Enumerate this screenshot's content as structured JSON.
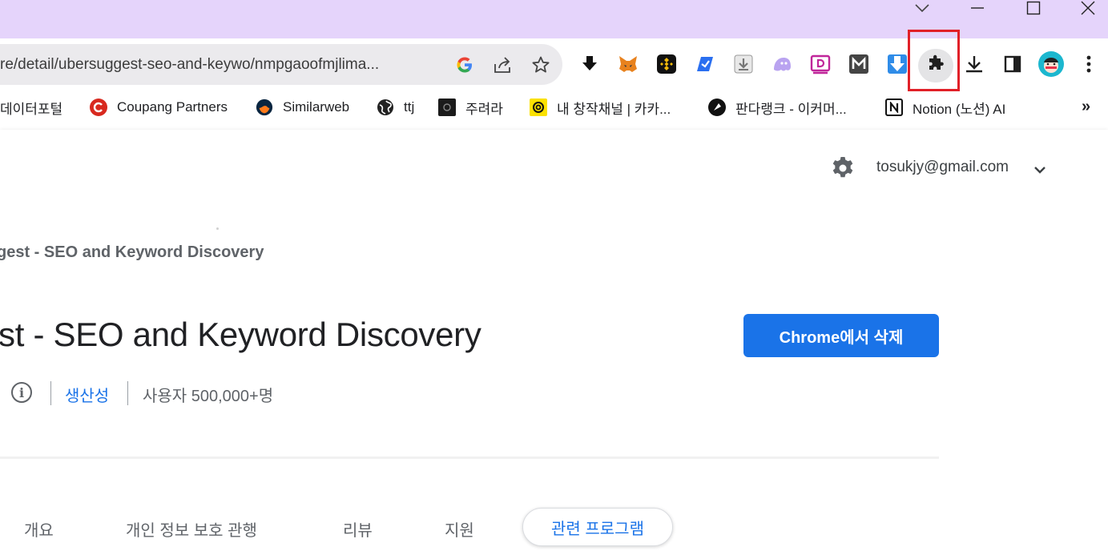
{
  "browser": {
    "url_text": "re/detail/ubersuggest-seo-and-keywo/nmpgaoofmjlima...",
    "accent_color": "#e5d4fb"
  },
  "bookmarks": [
    {
      "label": "데이터포털",
      "icon": "none"
    },
    {
      "label": "Coupang Partners",
      "icon": "coupang-icon"
    },
    {
      "label": "Similarweb",
      "icon": "similarweb-icon"
    },
    {
      "label": "ttj",
      "icon": "globe-icon"
    },
    {
      "label": "주려라",
      "icon": "site-icon"
    },
    {
      "label": "내 창작채널 | 카카...",
      "icon": "kakao-icon"
    },
    {
      "label": "판다랭크 - 이커머...",
      "icon": "pandarank-icon"
    },
    {
      "label": "Notion (노션) AI",
      "icon": "notion-icon"
    }
  ],
  "bookmarks_more": "»",
  "header": {
    "account_email": "tosukjy@gmail.com"
  },
  "extension": {
    "breadcrumb": "gest - SEO and Keyword Discovery",
    "title": "st - SEO and Keyword Discovery",
    "remove_button": "Chrome에서 삭제",
    "category": "생산성",
    "users": "사용자 500,000+명"
  },
  "tabs": {
    "overview": "개요",
    "privacy": "개인 정보 보호 관행",
    "reviews": "리뷰",
    "support": "지원",
    "related": "관련 프로그램"
  },
  "colors": {
    "primary_button": "#1a73e8",
    "highlight_frame": "#e12028"
  }
}
